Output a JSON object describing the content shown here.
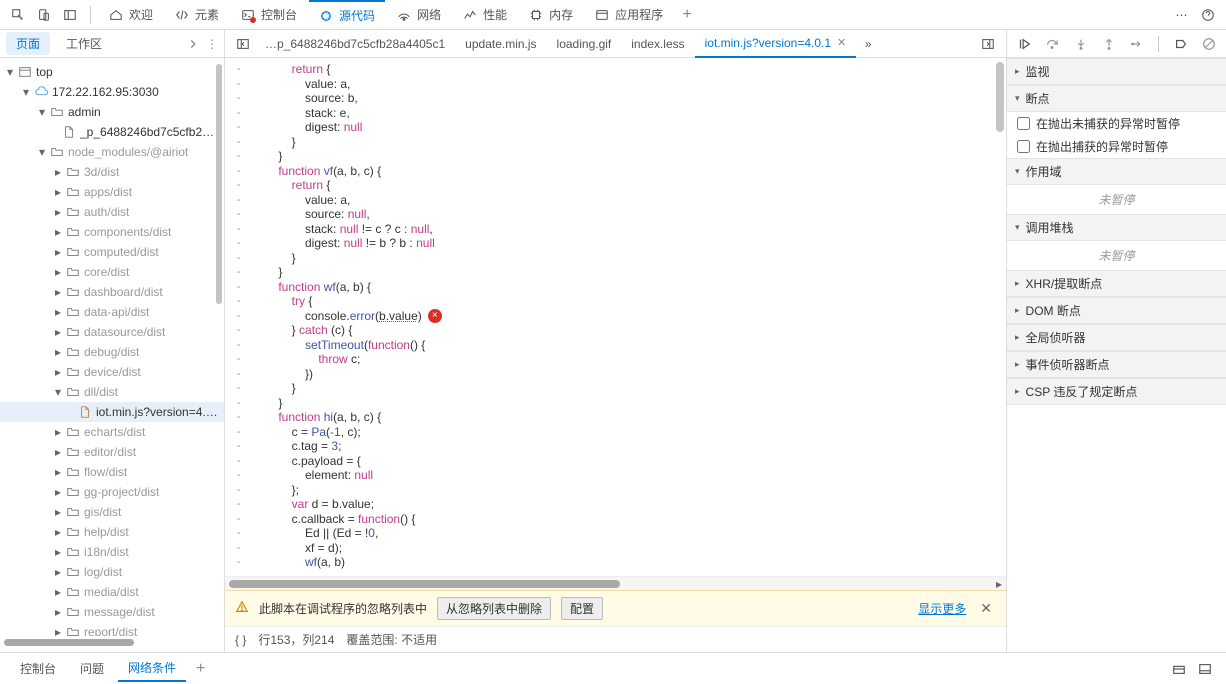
{
  "topTools": {
    "inspect": "inspect",
    "device": "device",
    "dock": "dock",
    "tabs": [
      {
        "key": "welcome",
        "label": "欢迎",
        "icon": "home-icon"
      },
      {
        "key": "elements",
        "label": "元素",
        "icon": "elements-icon"
      },
      {
        "key": "console",
        "label": "控制台",
        "icon": "console-icon"
      },
      {
        "key": "sources",
        "label": "源代码",
        "icon": "sources-icon",
        "active": true
      },
      {
        "key": "network",
        "label": "网络",
        "icon": "network-icon"
      },
      {
        "key": "performance",
        "label": "性能",
        "icon": "performance-icon"
      },
      {
        "key": "memory",
        "label": "内存",
        "icon": "memory-icon"
      },
      {
        "key": "application",
        "label": "应用程序",
        "icon": "application-icon"
      }
    ],
    "add": "+",
    "more": "⋯",
    "help": "?"
  },
  "leftTabs": {
    "page": "页面",
    "workspace": "工作区",
    "more": "⋮"
  },
  "tree": {
    "root": "top",
    "origin": "172.22.162.95:3030",
    "admin": "admin",
    "longfile": "_p_6488246bd7c5cfb28a…",
    "nodemod": "node_modules/@airiot",
    "selected": "iot.min.js?version=4.0…",
    "folders": [
      "3d/dist",
      "apps/dist",
      "auth/dist",
      "components/dist",
      "computed/dist",
      "core/dist",
      "dashboard/dist",
      "data-api/dist",
      "datasource/dist",
      "debug/dist",
      "device/dist",
      "dll/dist",
      "echarts/dist",
      "editor/dist",
      "flow/dist",
      "gg-project/dist",
      "gis/dist",
      "help/dist",
      "i18n/dist",
      "log/dist",
      "media/dist",
      "message/dist",
      "report/dist"
    ]
  },
  "fileTabs": {
    "items": [
      {
        "label": "…p_6488246bd7c5cfb28a4405c1"
      },
      {
        "label": "update.min.js"
      },
      {
        "label": "loading.gif"
      },
      {
        "label": "index.less"
      },
      {
        "label": "iot.min.js?version=4.0.1",
        "active": true,
        "close": true
      }
    ],
    "overflow": "»"
  },
  "code": {
    "lines": [
      {
        "i": 4,
        "t": "        return {"
      },
      {
        "i": 5,
        "t": "            value: a,"
      },
      {
        "i": 5,
        "t": "            source: b,"
      },
      {
        "i": 5,
        "t": "            stack: e,"
      },
      {
        "i": 5,
        "t": "            digest: null"
      },
      {
        "i": 4,
        "t": "        }"
      },
      {
        "i": 3,
        "t": "    }"
      },
      {
        "i": 3,
        "t": "    function vf(a, b, c) {"
      },
      {
        "i": 4,
        "t": "        return {"
      },
      {
        "i": 5,
        "t": "            value: a,"
      },
      {
        "i": 5,
        "t": "            source: null,"
      },
      {
        "i": 5,
        "t": "            stack: null != c ? c : null,"
      },
      {
        "i": 5,
        "t": "            digest: null != b ? b : null"
      },
      {
        "i": 4,
        "t": "        }"
      },
      {
        "i": 3,
        "t": "    }"
      },
      {
        "i": 3,
        "t": "    function wf(a, b) {"
      },
      {
        "i": 4,
        "t": "        try {"
      },
      {
        "i": 5,
        "t": "            console.error(b.value)",
        "err": true
      },
      {
        "i": 4,
        "t": "        } catch (c) {"
      },
      {
        "i": 5,
        "t": "            setTimeout(function() {"
      },
      {
        "i": 6,
        "t": "                throw c;"
      },
      {
        "i": 5,
        "t": "            })"
      },
      {
        "i": 4,
        "t": "        }"
      },
      {
        "i": 3,
        "t": "    }"
      },
      {
        "i": 3,
        "t": "    function hi(a, b, c) {"
      },
      {
        "i": 4,
        "t": "        c = Pa(-1, c);"
      },
      {
        "i": 4,
        "t": "        c.tag = 3;"
      },
      {
        "i": 4,
        "t": "        c.payload = {"
      },
      {
        "i": 5,
        "t": "            element: null"
      },
      {
        "i": 4,
        "t": "        };"
      },
      {
        "i": 4,
        "t": "        var d = b.value;"
      },
      {
        "i": 4,
        "t": "        c.callback = function() {"
      },
      {
        "i": 5,
        "t": "            Ed || (Ed = !0,"
      },
      {
        "i": 5,
        "t": "            xf = d);"
      },
      {
        "i": 5,
        "t": "            wf(a, b)"
      }
    ],
    "errGlyph": "×"
  },
  "warn": {
    "text": "此脚本在调试程序的忽略列表中",
    "btnRemove": "从忽略列表中删除",
    "btnConfig": "配置",
    "more": "显示更多"
  },
  "status": {
    "braces": "{ }",
    "posLabel": "行153，列214",
    "coverage": "覆盖范围: 不适用"
  },
  "right": {
    "watch": "监视",
    "bp": "断点",
    "chkUncaught": "在抛出未捕获的异常时暂停",
    "chkCaught": "在抛出捕获的异常时暂停",
    "scope": "作用域",
    "notPaused": "未暂停",
    "callstack": "调用堆栈",
    "xhr": "XHR/提取断点",
    "dom": "DOM 断点",
    "global": "全局侦听器",
    "event": "事件侦听器断点",
    "csp": "CSP 违反了规定断点"
  },
  "drawer": {
    "console": "控制台",
    "issues": "问题",
    "netcond": "网络条件"
  }
}
